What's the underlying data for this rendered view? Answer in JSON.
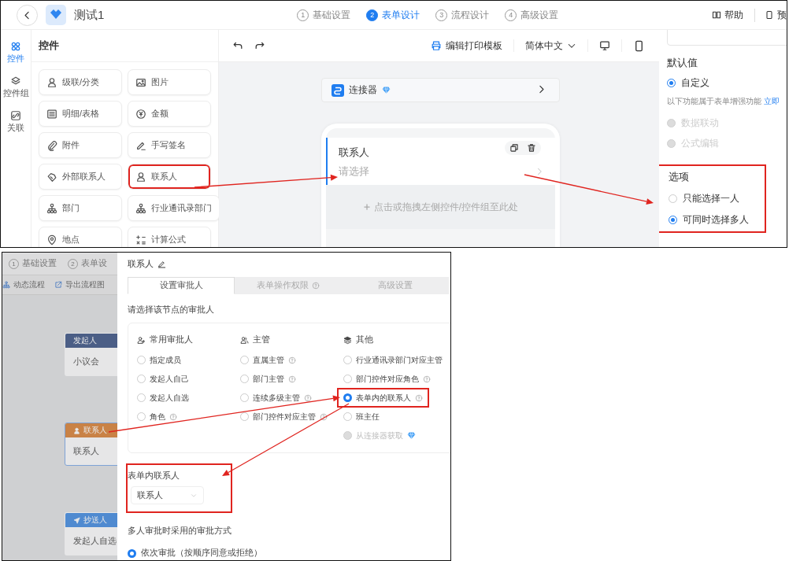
{
  "top_screen": {
    "header": {
      "title": "测试1",
      "steps": [
        {
          "number": "1",
          "label": "基础设置",
          "selected": false
        },
        {
          "number": "2",
          "label": "表单设计",
          "selected": true
        },
        {
          "number": "3",
          "label": "流程设计",
          "selected": false
        },
        {
          "number": "4",
          "label": "高级设置",
          "selected": false
        }
      ],
      "actions": [
        {
          "kind": "help",
          "label": "帮助"
        },
        {
          "kind": "preview",
          "label": "预"
        }
      ]
    },
    "rail": [
      {
        "kind": "widgets",
        "label": "控件",
        "selected": true
      },
      {
        "kind": "groups",
        "label": "控件组",
        "selected": false
      },
      {
        "kind": "links",
        "label": "关联",
        "selected": false
      }
    ],
    "widget_panel": {
      "title": "控件",
      "items": [
        {
          "kind": "cascade",
          "label": "级联/分类",
          "annotated": false
        },
        {
          "kind": "image",
          "label": "图片",
          "annotated": false
        },
        {
          "kind": "table",
          "label": "明细/表格",
          "annotated": false
        },
        {
          "kind": "money",
          "label": "金额",
          "annotated": false
        },
        {
          "kind": "attachment",
          "label": "附件",
          "annotated": false
        },
        {
          "kind": "signature",
          "label": "手写签名",
          "annotated": false
        },
        {
          "kind": "external",
          "label": "外部联系人",
          "annotated": false
        },
        {
          "kind": "contact",
          "label": "联系人",
          "annotated": true
        },
        {
          "kind": "department",
          "label": "部门",
          "annotated": false
        },
        {
          "kind": "department",
          "label": "行业通讯录部门",
          "annotated": false
        },
        {
          "kind": "location",
          "label": "地点",
          "annotated": false
        },
        {
          "kind": "formula",
          "label": "计算公式",
          "annotated": false
        }
      ]
    },
    "canvas": {
      "print_label": "编辑打印模板",
      "language": "简体中文",
      "connector": {
        "label": "连接器"
      },
      "field": {
        "label": "联系人",
        "placeholder": "请选择",
        "selected": true
      },
      "drop_hint": "点击或拖拽左侧控件/控件组至此处"
    },
    "properties": {
      "default_title": "默认值",
      "default_options": [
        {
          "label": "自定义",
          "selected": true,
          "disabled": false
        }
      ],
      "enhance_note": "以下功能属于表单增强功能",
      "enhance_link": "立即",
      "enhance_options": [
        {
          "label": "数据联动",
          "selected": false,
          "disabled": true
        },
        {
          "label": "公式编辑",
          "selected": false,
          "disabled": true
        }
      ],
      "options_title": "选项",
      "options_annotated": true,
      "options": [
        {
          "label": "只能选择一人",
          "selected": false,
          "disabled": false
        },
        {
          "label": "可同时选择多人",
          "selected": true,
          "disabled": false
        }
      ]
    }
  },
  "bottom_screen": {
    "flow": {
      "steps": [
        {
          "number": "1",
          "label": "基础设置"
        },
        {
          "number": "2",
          "label": "表单设"
        }
      ],
      "toolbar": [
        {
          "kind": "dynamic",
          "label": "动态流程"
        },
        {
          "kind": "export",
          "label": "导出流程图"
        }
      ],
      "nodes": [
        {
          "kind": "initiator",
          "title": "发起人",
          "body": "小议会",
          "color": "#4b5e86",
          "selected": false
        },
        {
          "kind": "approver",
          "title": "联系人",
          "body": "联系人",
          "color": "#c98246",
          "selected": true
        },
        {
          "kind": "cc",
          "title": "抄送人",
          "body": "发起人自选",
          "color": "#4f8ad0",
          "selected": false
        }
      ]
    },
    "drawer": {
      "title": "联系人",
      "tabs": [
        {
          "label": "设置审批人",
          "help": false,
          "selected": true
        },
        {
          "label": "表单操作权限",
          "help": true,
          "selected": false
        },
        {
          "label": "高级设置",
          "help": false,
          "selected": false
        }
      ],
      "prompt": "请选择该节点的审批人",
      "groups": [
        {
          "kind": "common",
          "title": "常用审批人",
          "options": [
            {
              "label": "指定成员",
              "help": false,
              "selected": false,
              "disabled": false,
              "premium": false,
              "annotated": false
            },
            {
              "label": "发起人自己",
              "help": false,
              "selected": false,
              "disabled": false,
              "premium": false,
              "annotated": false
            },
            {
              "label": "发起人自选",
              "help": false,
              "selected": false,
              "disabled": false,
              "premium": false,
              "annotated": false
            },
            {
              "label": "角色",
              "help": true,
              "selected": false,
              "disabled": false,
              "premium": false,
              "annotated": false
            }
          ]
        },
        {
          "kind": "manager",
          "title": "主管",
          "options": [
            {
              "label": "直属主管",
              "help": true,
              "selected": false,
              "disabled": false,
              "premium": false,
              "annotated": false
            },
            {
              "label": "部门主管",
              "help": true,
              "selected": false,
              "disabled": false,
              "premium": false,
              "annotated": false
            },
            {
              "label": "连续多级主管",
              "help": true,
              "selected": false,
              "disabled": false,
              "premium": false,
              "annotated": false
            },
            {
              "label": "部门控件对应主管",
              "help": true,
              "selected": false,
              "disabled": false,
              "premium": false,
              "annotated": false
            }
          ]
        },
        {
          "kind": "other",
          "title": "其他",
          "options": [
            {
              "label": "行业通讯录部门对应主管",
              "help": false,
              "selected": false,
              "disabled": false,
              "premium": false,
              "annotated": false
            },
            {
              "label": "部门控件对应角色",
              "help": true,
              "selected": false,
              "disabled": false,
              "premium": false,
              "annotated": false
            },
            {
              "label": "表单内的联系人",
              "help": true,
              "selected": true,
              "disabled": false,
              "premium": false,
              "annotated": true
            },
            {
              "label": "班主任",
              "help": false,
              "selected": false,
              "disabled": false,
              "premium": false,
              "annotated": false
            },
            {
              "label": "从连接器获取",
              "help": false,
              "selected": false,
              "disabled": true,
              "premium": true,
              "annotated": false
            }
          ]
        }
      ],
      "form_contact": {
        "label": "表单内联系人",
        "value": "联系人",
        "annotated": true
      },
      "mode_title": "多人审批时采用的审批方式",
      "modes": [
        {
          "label": "依次审批（按顺序同意或拒绝）",
          "selected": true
        }
      ]
    }
  }
}
